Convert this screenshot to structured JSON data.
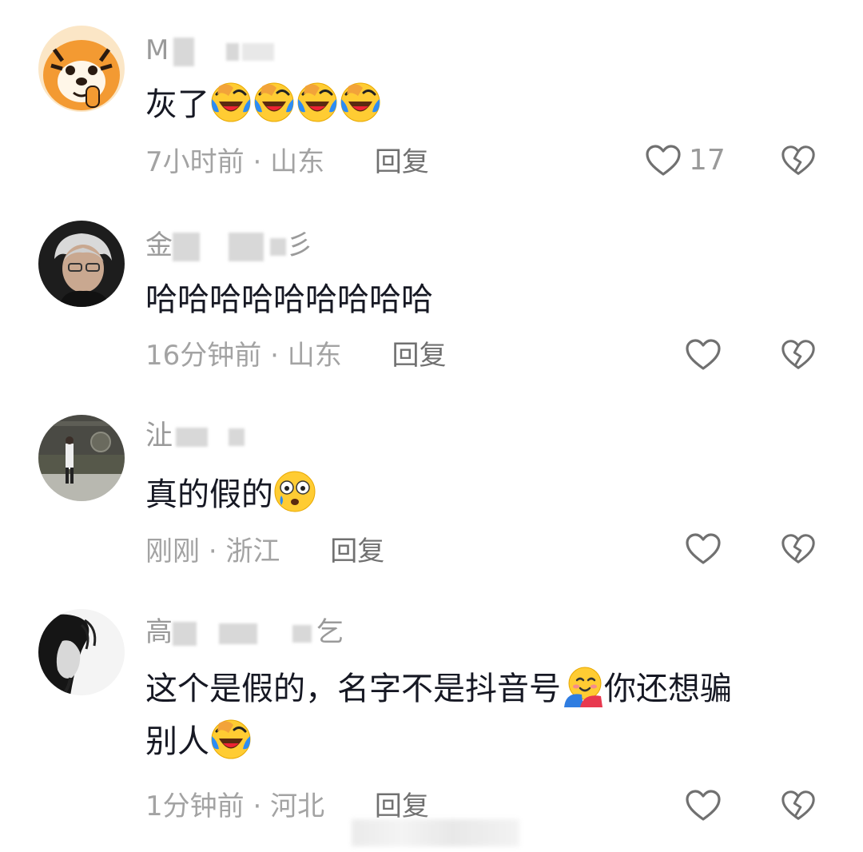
{
  "comments": [
    {
      "username_visible": "M",
      "text": "灰了",
      "emojis": [
        "laugh-cry",
        "laugh-cry",
        "laugh-cry",
        "laugh-cry"
      ],
      "time": "7小时前",
      "location": "山东",
      "reply_label": "回复",
      "like_count": "17",
      "avatar": "tiger-avatar"
    },
    {
      "username_visible_start": "金",
      "username_visible_end": "彡",
      "text": "哈哈哈哈哈哈哈哈哈",
      "emojis": [],
      "time": "16分钟前",
      "location": "山东",
      "reply_label": "回复",
      "like_count": "",
      "avatar": "gray-hair-man-avatar"
    },
    {
      "username_visible": "沚",
      "text": "真的假的",
      "emojis": [
        "surprised-tear"
      ],
      "time": "刚刚",
      "location": "浙江",
      "reply_label": "回复",
      "like_count": "",
      "avatar": "street-person-avatar"
    },
    {
      "username_visible_start": "高",
      "username_visible_end": "乞",
      "text_line1": "这个是假的，名字不是抖音号",
      "text_line1_after_emoji": "你还想骗",
      "text_line2": "别人",
      "emojis": [
        "hug-face",
        "laugh-cry"
      ],
      "time": "1分钟前",
      "location": "河北",
      "reply_label": "回复",
      "like_count": "",
      "avatar": "bw-portrait-avatar"
    }
  ],
  "separator": "·",
  "icons": {
    "like": "heart-outline-icon",
    "dislike": "broken-heart-icon"
  },
  "colors": {
    "primary_text": "#161823",
    "secondary_text": "#a3a3a3",
    "username": "#9a9a9a",
    "icon_stroke": "#6f6f6f"
  }
}
